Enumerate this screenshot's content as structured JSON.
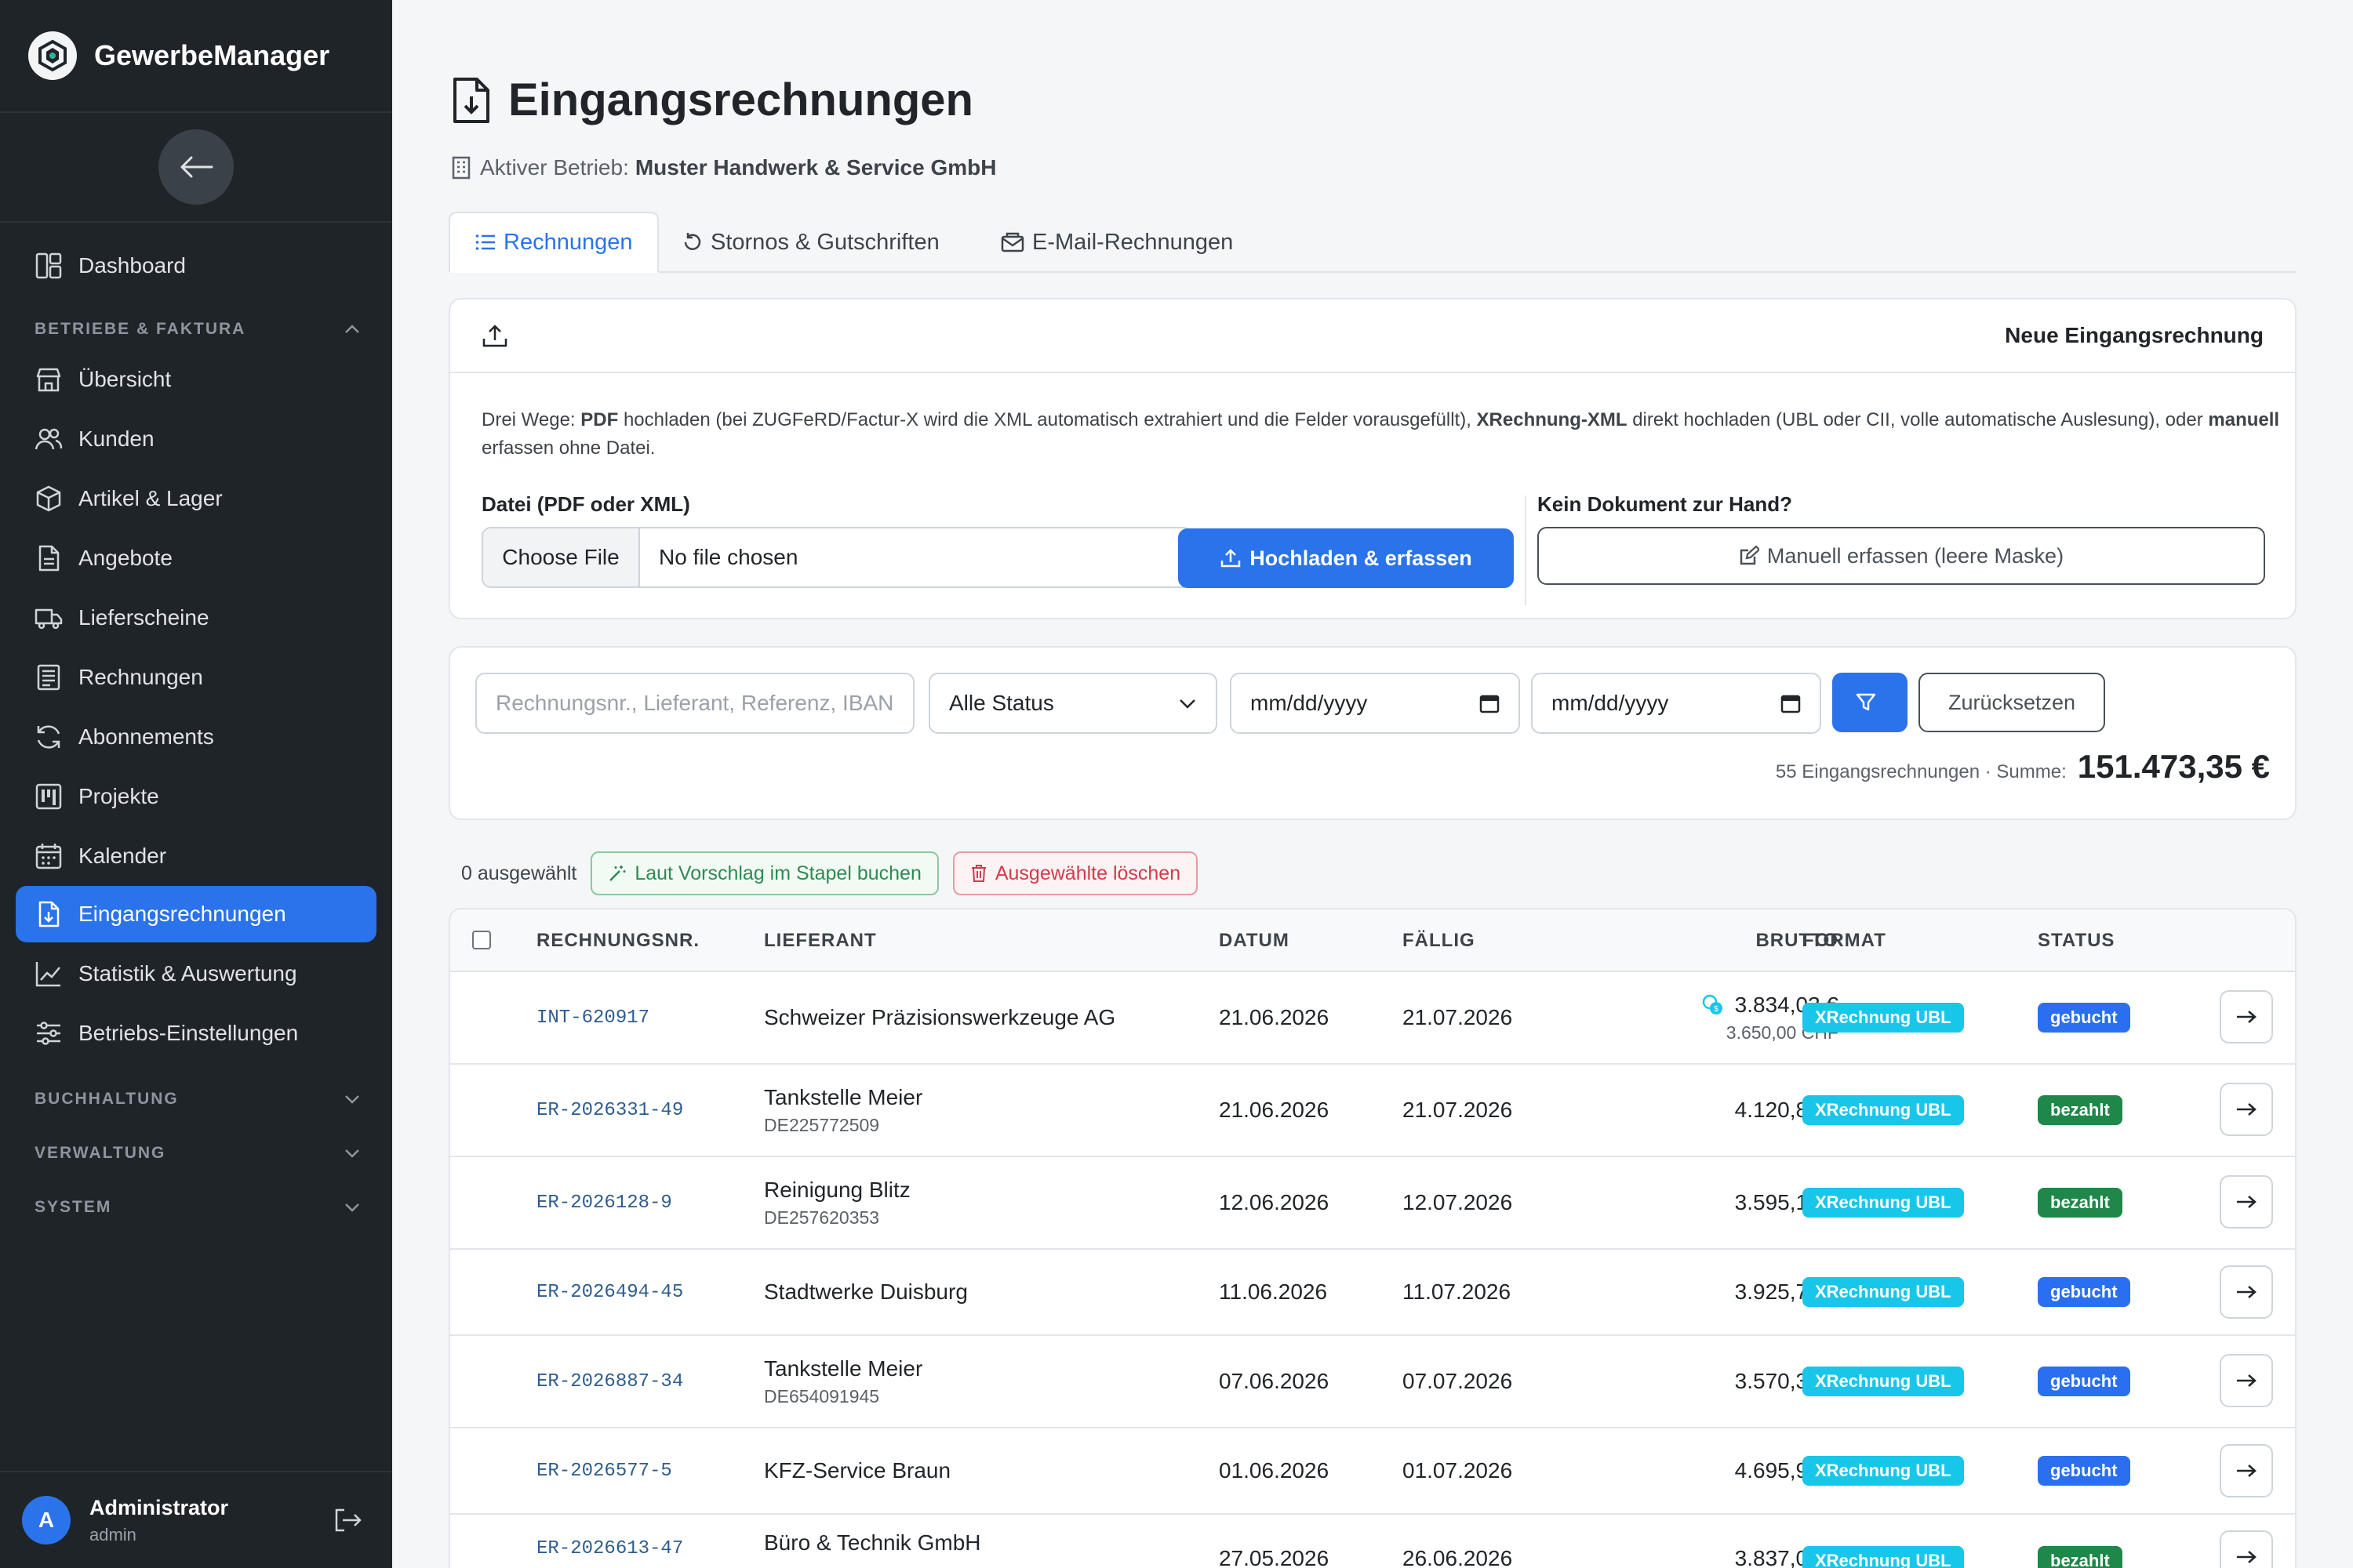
{
  "app": {
    "name": "GewerbeManager"
  },
  "sidebar": {
    "items": [
      {
        "label": "Dashboard"
      },
      {
        "label": "Übersicht"
      },
      {
        "label": "Kunden"
      },
      {
        "label": "Artikel & Lager"
      },
      {
        "label": "Angebote"
      },
      {
        "label": "Lieferscheine"
      },
      {
        "label": "Rechnungen"
      },
      {
        "label": "Abonnements"
      },
      {
        "label": "Projekte"
      },
      {
        "label": "Kalender"
      },
      {
        "label": "Eingangsrechnungen",
        "active": true
      },
      {
        "label": "Statistik & Auswertung"
      },
      {
        "label": "Betriebs-Einstellungen"
      }
    ],
    "sections": [
      "BETRIEBE & FAKTURA",
      "BUCHHALTUNG",
      "VERWALTUNG",
      "SYSTEM"
    ],
    "user": {
      "initial": "A",
      "name": "Administrator",
      "role": "admin"
    }
  },
  "page": {
    "title": "Eingangsrechnungen",
    "company_label": "Aktiver Betrieb:",
    "company_name": "Muster Handwerk & Service GmbH"
  },
  "tabs": [
    {
      "label": "Rechnungen",
      "active": true
    },
    {
      "label": "Stornos & Gutschriften"
    },
    {
      "label": "E-Mail-Rechnungen"
    }
  ],
  "upload": {
    "header": "Neue Eingangsrechnung",
    "desc_1": "Drei Wege: ",
    "desc_2": "PDF",
    "desc_3": " hochladen (bei ZUGFeRD/Factur-X wird die XML automatisch extrahiert und die Felder vorausgefüllt), ",
    "desc_4": "XRechnung-XML",
    "desc_5": " direkt hochladen (UBL oder CII, volle automatische Auslesung), oder ",
    "desc_6": "manuell",
    "desc_7": " erfassen ohne Datei.",
    "file_label": "Datei (PDF oder XML)",
    "choose_file": "Choose File",
    "no_file": "No file chosen",
    "upload_button": "Hochladen & erfassen",
    "manual_label": "Kein Dokument zur Hand?",
    "manual_button": "Manuell erfassen (leere Maske)"
  },
  "filters": {
    "search_placeholder": "Rechnungsnr., Lieferant, Referenz, IBAN",
    "status_value": "Alle Status",
    "date_from": "mm/dd/yyyy",
    "date_to": "mm/dd/yyyy",
    "reset_button": "Zurücksetzen",
    "count_text": "55 Eingangsrechnungen · Summe:",
    "sum": "151.473,35 €"
  },
  "bulk": {
    "selected_text": "0 ausgewählt",
    "book_button": "Laut Vorschlag im Stapel buchen",
    "delete_button": "Ausgewählte löschen"
  },
  "table": {
    "columns": [
      "RECHNUNGSNR.",
      "LIEFERANT",
      "DATUM",
      "FÄLLIG",
      "BRUTTO",
      "FORMAT",
      "STATUS"
    ],
    "rows": [
      {
        "nr": "INT-620917",
        "supplier": "Schweizer Präzisionswerkzeuge AG",
        "vat": "",
        "date": "21.06.2026",
        "due": "21.07.2026",
        "gross": "3.834,03 €",
        "gross_sub": "3.650,00 CHF",
        "format": "XRechnung UBL",
        "status": "gebucht",
        "status_color": "#2a6ff0"
      },
      {
        "nr": "ER-2026331-49",
        "supplier": "Tankstelle Meier",
        "vat": "DE225772509",
        "date": "21.06.2026",
        "due": "21.07.2026",
        "gross": "4.120,87 €",
        "gross_sub": "",
        "format": "XRechnung UBL",
        "status": "bezahlt",
        "status_color": "#1e8749"
      },
      {
        "nr": "ER-2026128-9",
        "supplier": "Reinigung Blitz",
        "vat": "DE257620353",
        "date": "12.06.2026",
        "due": "12.07.2026",
        "gross": "3.595,18 €",
        "gross_sub": "",
        "format": "XRechnung UBL",
        "status": "bezahlt",
        "status_color": "#1e8749"
      },
      {
        "nr": "ER-2026494-45",
        "supplier": "Stadtwerke Duisburg",
        "vat": "",
        "date": "11.06.2026",
        "due": "11.07.2026",
        "gross": "3.925,79 €",
        "gross_sub": "",
        "format": "XRechnung UBL",
        "status": "gebucht",
        "status_color": "#2a6ff0"
      },
      {
        "nr": "ER-2026887-34",
        "supplier": "Tankstelle Meier",
        "vat": "DE654091945",
        "date": "07.06.2026",
        "due": "07.07.2026",
        "gross": "3.570,32 €",
        "gross_sub": "",
        "format": "XRechnung UBL",
        "status": "gebucht",
        "status_color": "#2a6ff0"
      },
      {
        "nr": "ER-2026577-5",
        "supplier": "KFZ-Service Braun",
        "vat": "",
        "date": "01.06.2026",
        "due": "01.07.2026",
        "gross": "4.695,99 €",
        "gross_sub": "",
        "format": "XRechnung UBL",
        "status": "gebucht",
        "status_color": "#2a6ff0"
      },
      {
        "nr": "ER-2026613-47",
        "supplier": "Büro & Technik GmbH",
        "vat": "",
        "date": "27.05.2026",
        "due": "26.06.2026",
        "gross": "3.837,02 €",
        "gross_sub": "",
        "format": "XRechnung UBL",
        "status": "bezahlt",
        "status_color": "#1e8749"
      }
    ]
  },
  "colors": {
    "accent": "#2a73ea",
    "sidebar_bg": "#1f2429",
    "format_badge": "#18c6ea",
    "status_booked": "#2a6ff0",
    "status_paid": "#1e8749"
  }
}
